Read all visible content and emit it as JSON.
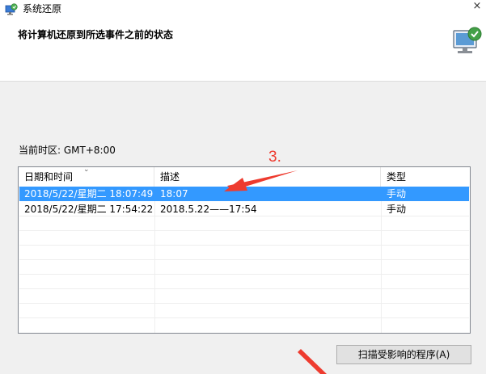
{
  "window": {
    "title": "系统还原",
    "close_glyph": "×",
    "heading": "将计算机还原到所选事件之前的状态"
  },
  "timezone_label": "当前时区: GMT+8:00",
  "table": {
    "columns": [
      "日期和时间",
      "描述",
      "类型"
    ],
    "sort_glyph": "⌄",
    "rows": [
      {
        "datetime": "2018/5/22/星期二 18:07:49",
        "description": "18:07",
        "type": "手动",
        "selected": true
      },
      {
        "datetime": "2018/5/22/星期二 17:54:22",
        "description": "2018.5.22——17:54",
        "type": "手动",
        "selected": false
      }
    ]
  },
  "scan_button_label": "扫描受影响的程序(A)",
  "annotation_number": "3.",
  "colors": {
    "selection": "#3399ff",
    "annotation": "#ee3b2f"
  }
}
